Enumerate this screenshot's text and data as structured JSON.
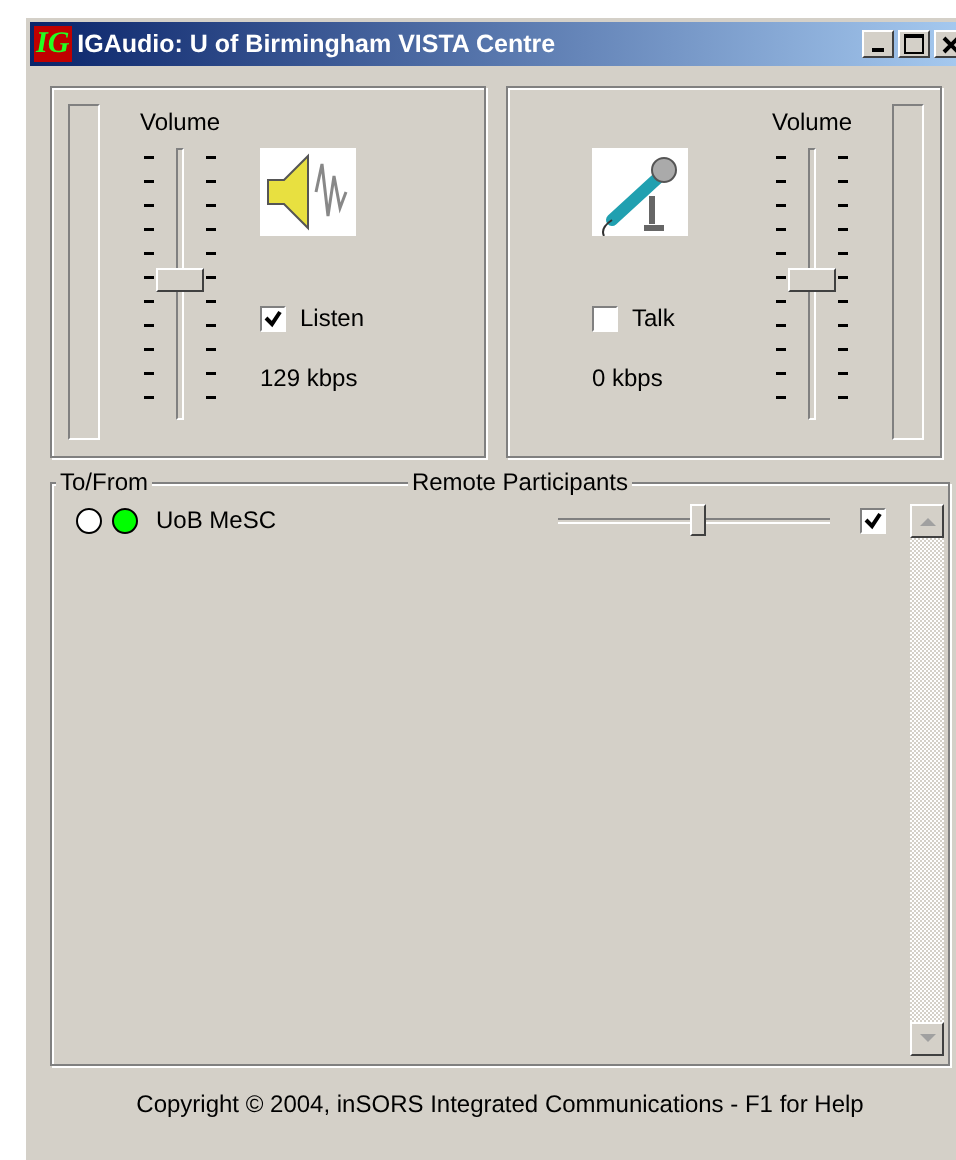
{
  "window": {
    "logo": "IG",
    "title": "IGAudio: U of Birmingham VISTA Centre"
  },
  "channels": [
    {
      "kind": "speaker",
      "title": "Volume",
      "level": 0.5,
      "toggle_label": "Listen",
      "checked": true,
      "rate": "129 kbps"
    },
    {
      "kind": "microphone",
      "title": "Volume",
      "level": 0.5,
      "toggle_label": "Talk",
      "checked": false,
      "rate": "0 kbps"
    }
  ],
  "participants": {
    "legend_left": "To/From",
    "legend_right": "Remote Participants",
    "rows": [
      {
        "indicators": [
          {
            "color": "#ffffff"
          },
          {
            "color": "#00ff00"
          }
        ],
        "name": "UoB MeSC",
        "level": 0.52,
        "checked": true
      }
    ]
  },
  "status_bar": "Copyright © 2004, inSORS Integrated Communications - F1 for Help"
}
